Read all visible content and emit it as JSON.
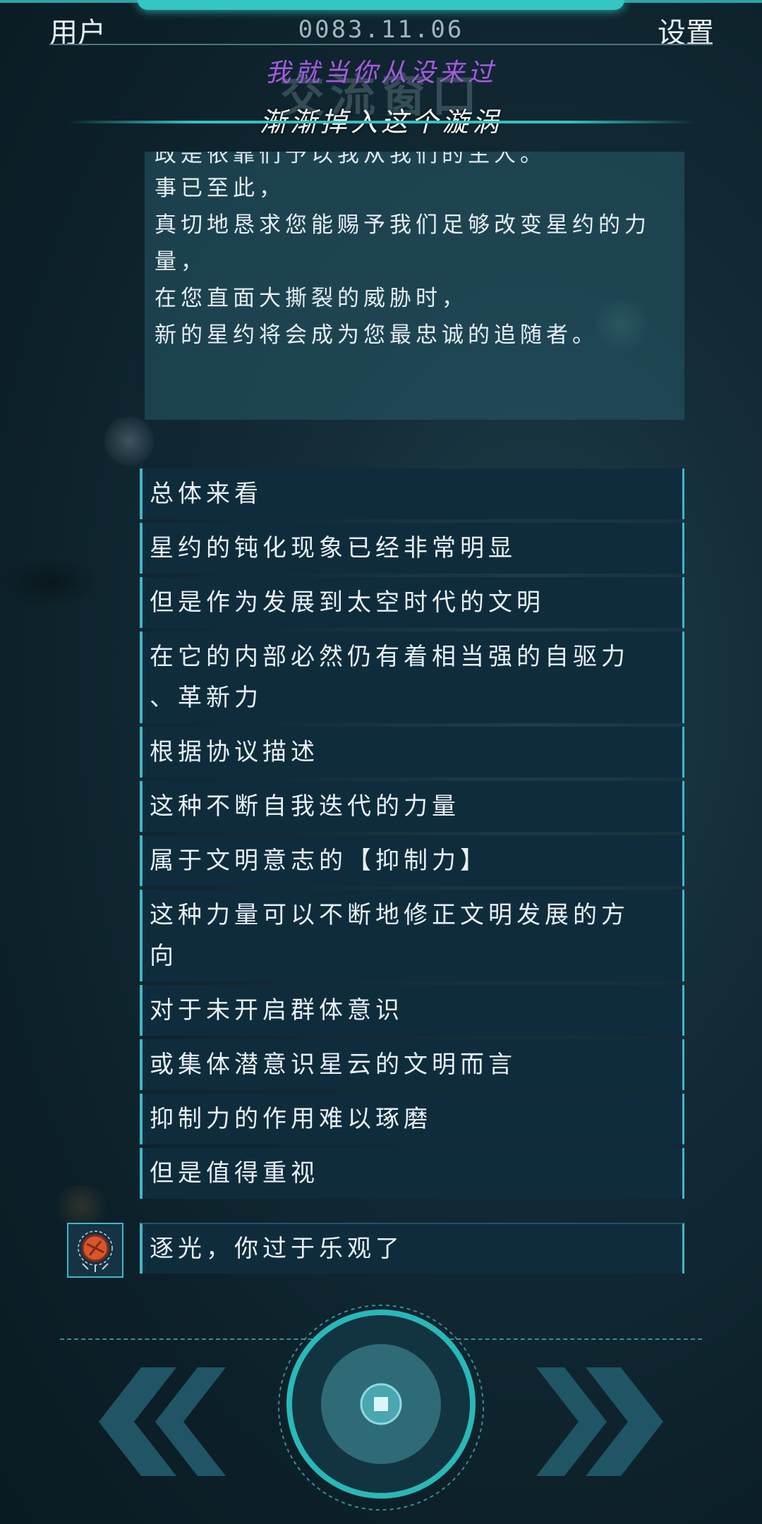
{
  "header": {
    "user_label": "用户",
    "date": "0083.11.06",
    "settings_label": "设置"
  },
  "window": {
    "title": "交流窗口",
    "lyric_line1": "我就当你从没来过",
    "lyric_line2": "渐渐掉入这个漩涡"
  },
  "message": {
    "partial_line": "政是依靠们予以我从我们的主人。",
    "lines": [
      "事已至此，",
      "真切地恳求您能赐予我们足够改变星约的力",
      "量，",
      "在您直面大撕裂的威胁时，",
      "新的星约将会成为您最忠诚的追随者。"
    ]
  },
  "dialogue": [
    "总体来看",
    "星约的钝化现象已经非常明显",
    "但是作为发展到太空时代的文明",
    [
      "在它的内部必然仍有着相当强的自驱力",
      "、革新力"
    ],
    "根据协议描述",
    "这种不断自我迭代的力量",
    "属于文明意志的【抑制力】",
    [
      "这种力量可以不断地修正文明发展的方",
      "向"
    ],
    "对于未开启群体意识",
    "或集体潜意识星云的文明而言",
    "抑制力的作用难以琢磨",
    "但是值得重视"
  ],
  "current_speaker_line": "逐光，你过于乐观了",
  "controls": {
    "prev_icon": "double-chevron-left-icon",
    "next_icon": "double-chevron-right-icon",
    "center_icon": "advance-circle-icon"
  },
  "colors": {
    "accent": "#35c2c0",
    "row_bg": "#0f2c3d",
    "lyric_purple": "#a45ae0"
  }
}
